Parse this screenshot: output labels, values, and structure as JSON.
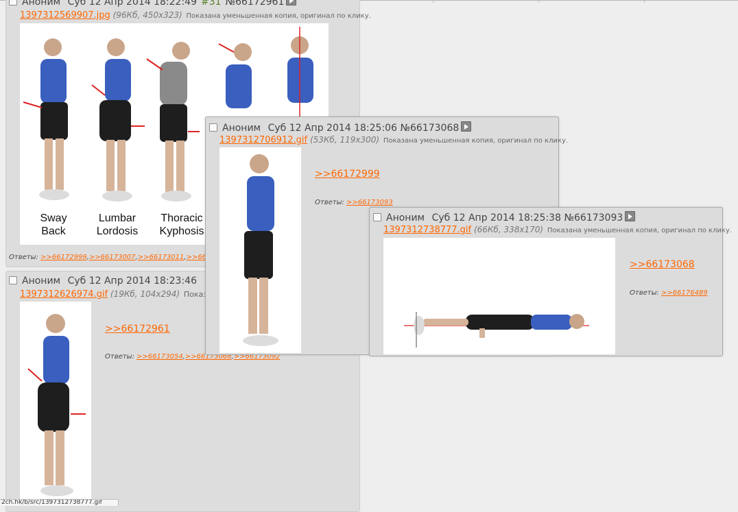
{
  "posts": [
    {
      "name": "Аноним",
      "date": "Суб 12 Апр 2014 18:22:49",
      "index": "#31",
      "number": "№66172961",
      "file_name": "1397312569907.jpg",
      "file_meta": "(96Кб, 450x323)",
      "note": "Показана уменьшенная копия, оригинал по клику.",
      "image_labels": [
        "Sway",
        "Back",
        "Lumbar",
        "Lordosis",
        "Thoracic",
        "Kyphosis"
      ],
      "answers_label": "Ответы:",
      "answers": [
        ">>66172999",
        ">>66173007",
        ">>66173011",
        ">>661"
      ]
    },
    {
      "name": "Аноним",
      "date": "Суб 12 Апр 2014 18:23:46",
      "file_name": "1397312626974.gif",
      "file_meta": "(19Кб, 104x294)",
      "note": "Показа",
      "reply_link": ">>66172961",
      "answers_label": "Ответы:",
      "answers": [
        ">>66173054",
        ">>66173068",
        ">>66173092"
      ]
    }
  ],
  "popups": [
    {
      "name": "Аноним",
      "date": "Суб 12 Апр 2014 18:25:06",
      "number": "№66173068",
      "file_name": "1397312706912.gif",
      "file_meta": "(53Кб, 119x300)",
      "note": "Показана уменьшенная копия, оригинал по клику.",
      "reply_link": ">>66172999",
      "answers_label": "Ответы:",
      "answers": [
        ">>66173093"
      ]
    },
    {
      "name": "Аноним",
      "date": "Суб 12 Апр 2014 18:25:38",
      "number": "№66173093",
      "file_name": "1397312738777.gif",
      "file_meta": "(66Кб, 338x170)",
      "note": "Показана уменьшенная копия, оригинал по клику.",
      "reply_link": ">>66173068",
      "answers_label": "Ответы:",
      "answers": [
        ">>66176489"
      ]
    }
  ],
  "status_bar": "2ch.hk/b/src/1397312738777.gif",
  "colors": {
    "link": "#ff6600",
    "post_number": "#5a7f2b",
    "shirt": "#3a5fbf",
    "post_bg": "#dddddd"
  },
  "icons": [
    "checkbox-icon",
    "play-icon"
  ]
}
